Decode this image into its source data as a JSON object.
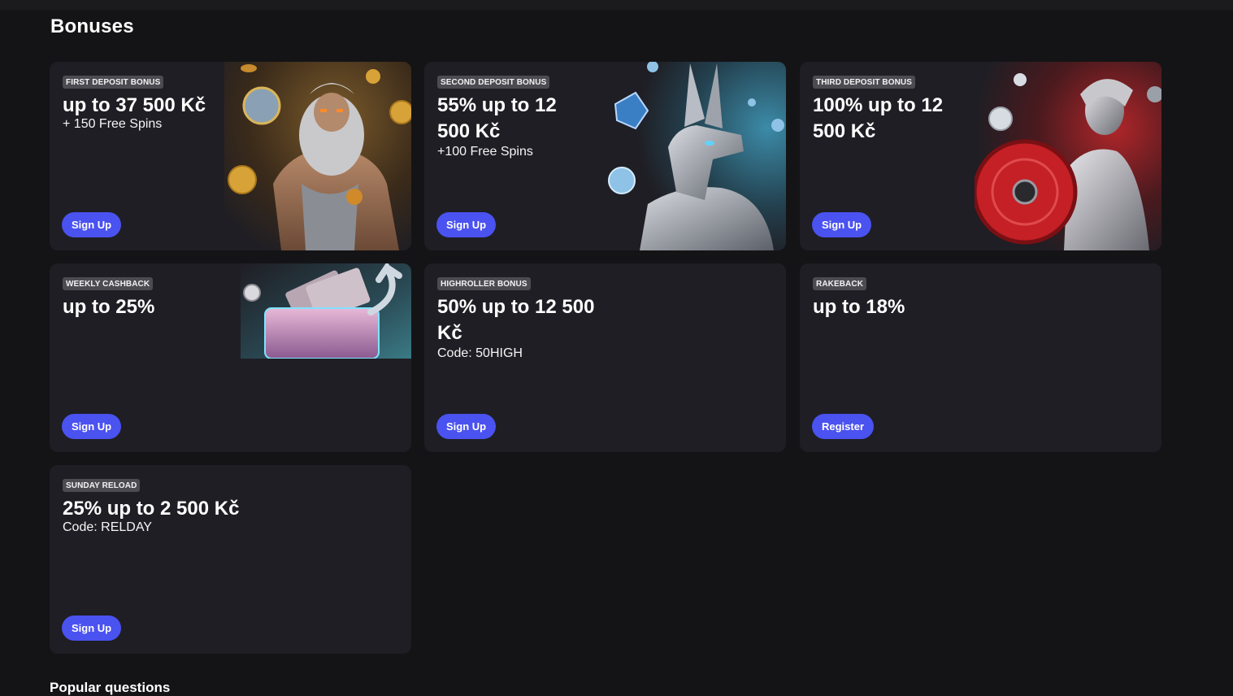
{
  "page": {
    "title": "Bonuses",
    "next_section": "Popular questions"
  },
  "colors": {
    "background": "#141416",
    "card": "#1f1e24",
    "tag": "#4d4b52",
    "accent": "#4a52f0"
  },
  "bonuses": [
    {
      "tag": "FIRST DEPOSIT BONUS",
      "headline": "up to 37 500 Kč",
      "sub": "+ 150 Free Spins",
      "cta": "Sign Up",
      "art": "zeus-with-bonus-coin-illustration"
    },
    {
      "tag": "SECOND DEPOSIT BONUS",
      "headline": "55% up to 12 500 Kč",
      "sub": "+100 Free Spins",
      "cta": "Sign Up",
      "art": "anubis-with-wild-gem-illustration"
    },
    {
      "tag": "THIRD DEPOSIT BONUS",
      "headline": "100% up to 12 500 Kč",
      "sub": "",
      "cta": "Sign Up",
      "art": "athena-with-shield-illustration"
    },
    {
      "tag": "WEEKLY CASHBACK",
      "headline": "up to 25%",
      "sub": "",
      "cta": "Sign Up",
      "art": "cashback-wallet-illustration"
    },
    {
      "tag": "HIGHROLLER BONUS",
      "headline": "50% up to 12 500 Kč",
      "sub": "Code: 50HIGH",
      "cta": "Sign Up",
      "art": ""
    },
    {
      "tag": "RAKEBACK",
      "headline": "up to 18%",
      "sub": "",
      "cta": "Register",
      "art": ""
    },
    {
      "tag": "SUNDAY RELOAD",
      "headline": "25% up to 2 500 Kč",
      "sub": "Code: RELDAY",
      "cta": "Sign Up",
      "art": ""
    }
  ]
}
